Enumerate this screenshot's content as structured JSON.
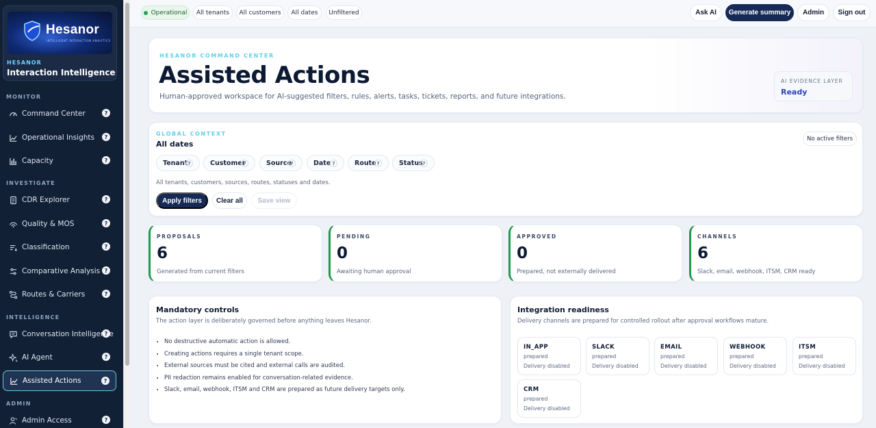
{
  "sidebar": {
    "brand": {
      "logo_text": "Hesanor",
      "logo_tagline": "INTELLIGENT INTERACTION ANALYTICS",
      "kicker": "HESANOR",
      "name": "Interaction Intelligence"
    },
    "sections": [
      {
        "label": "MONITOR"
      },
      {
        "label": "INVESTIGATE"
      },
      {
        "label": "INTELLIGENCE"
      },
      {
        "label": "ADMIN"
      }
    ],
    "items": [
      {
        "label": "Command Center",
        "icon": "gauge-icon",
        "help": "?"
      },
      {
        "label": "Operational Insights",
        "icon": "trend-chart-icon",
        "help": "?"
      },
      {
        "label": "Capacity",
        "icon": "bar-chart-icon",
        "help": "?"
      },
      {
        "label": "CDR Explorer",
        "icon": "document-icon",
        "help": "?"
      },
      {
        "label": "Quality & MOS",
        "icon": "signal-icon",
        "help": "?"
      },
      {
        "label": "Classification",
        "icon": "sort-lines-icon",
        "help": "?"
      },
      {
        "label": "Comparative Analysis",
        "icon": "sliders-icon",
        "help": "?"
      },
      {
        "label": "Routes & Carriers",
        "icon": "route-icon",
        "help": "?"
      },
      {
        "label": "Conversation Intelligence",
        "icon": "chat-icon",
        "help": "?"
      },
      {
        "label": "AI Agent",
        "icon": "sparkle-icon",
        "help": "?"
      },
      {
        "label": "Assisted Actions",
        "icon": "assisted-actions-icon",
        "help": "?"
      },
      {
        "label": "Admin Access",
        "icon": "user-icon",
        "help": "?"
      }
    ]
  },
  "topbar": {
    "status": "Operational",
    "scope_pills": [
      "All tenants",
      "All customers",
      "All dates",
      "Unfiltered"
    ],
    "ask_ai": "Ask AI",
    "generate_summary": "Generate summary",
    "admin": "Admin",
    "sign_out": "Sign out"
  },
  "hero": {
    "kicker": "HESANOR COMMAND CENTER",
    "title": "Assisted Actions",
    "subtitle": "Human-approved workspace for AI-suggested filters, rules, alerts, tasks, tickets, reports, and future integrations.",
    "evidence_label": "AI EVIDENCE LAYER",
    "evidence_value": "Ready"
  },
  "context": {
    "kicker": "GLOBAL CONTEXT",
    "title": "All dates",
    "no_active": "No active filters",
    "filters": [
      "Tenant",
      "Customer",
      "Source",
      "Date",
      "Route",
      "Status"
    ],
    "help": "?",
    "note": "All tenants, customers, sources, routes, statuses and dates.",
    "apply": "Apply filters",
    "clear": "Clear all",
    "save": "Save view"
  },
  "stats": [
    {
      "label": "PROPOSALS",
      "value": "6",
      "caption": "Generated from current filters"
    },
    {
      "label": "PENDING",
      "value": "0",
      "caption": "Awaiting human approval"
    },
    {
      "label": "APPROVED",
      "value": "0",
      "caption": "Prepared, not externally delivered"
    },
    {
      "label": "CHANNELS",
      "value": "6",
      "caption": "Slack, email, webhook, ITSM, CRM ready"
    }
  ],
  "controls": {
    "title": "Mandatory controls",
    "subtitle": "The action layer is deliberately governed before anything leaves Hesanor.",
    "items": [
      "No destructive automatic action is allowed.",
      "Creating actions requires a single tenant scope.",
      "External sources must be cited and external calls are audited.",
      "PII redaction remains enabled for conversation-related evidence.",
      "Slack, email, webhook, ITSM and CRM are prepared as future delivery targets only."
    ]
  },
  "integration": {
    "title": "Integration readiness",
    "subtitle": "Delivery channels are prepared for controlled rollout after approval workflows mature.",
    "channels": [
      {
        "name": "IN_APP",
        "state": "prepared",
        "delivery": "Delivery disabled"
      },
      {
        "name": "SLACK",
        "state": "prepared",
        "delivery": "Delivery disabled"
      },
      {
        "name": "EMAIL",
        "state": "prepared",
        "delivery": "Delivery disabled"
      },
      {
        "name": "WEBHOOK",
        "state": "prepared",
        "delivery": "Delivery disabled"
      },
      {
        "name": "ITSM",
        "state": "prepared",
        "delivery": "Delivery disabled"
      },
      {
        "name": "CRM",
        "state": "prepared",
        "delivery": "Delivery disabled"
      }
    ]
  }
}
